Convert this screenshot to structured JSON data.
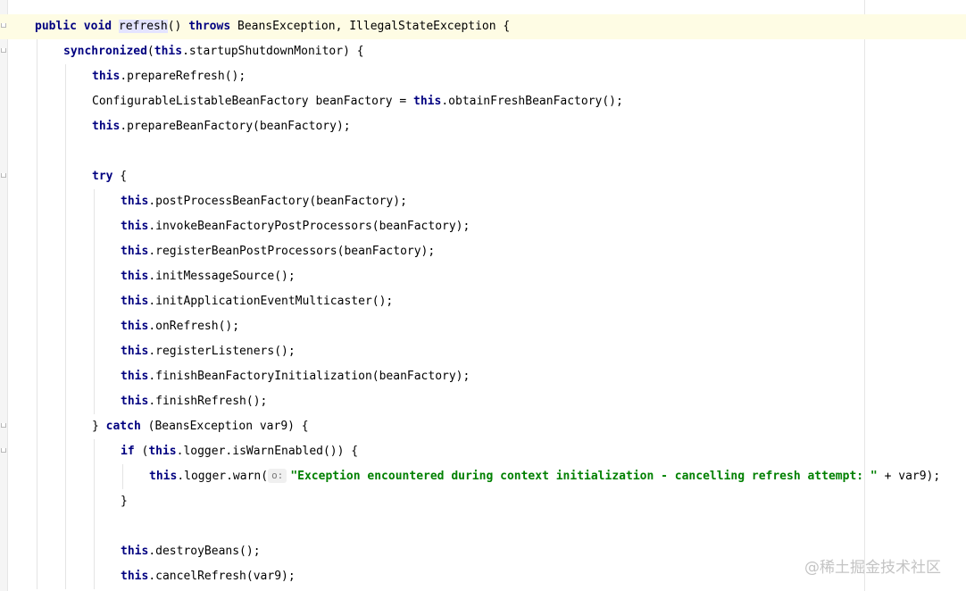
{
  "watermark": "@稀土掘金技术社区",
  "colors": {
    "keyword": "#000080",
    "string": "#008000",
    "current_line": "#fefce4",
    "usage_highlight": "#e4e4ff"
  },
  "code": {
    "lines": [
      {
        "indent": 1,
        "current": true,
        "tokens": [
          {
            "t": "public void ",
            "k": "kw"
          },
          {
            "t": "refresh",
            "k": "hl"
          },
          {
            "t": "() ",
            "k": ""
          },
          {
            "t": "throws",
            "k": "kw"
          },
          {
            "t": " BeansException, IllegalStateException {",
            "k": ""
          }
        ]
      },
      {
        "indent": 2,
        "tokens": [
          {
            "t": "synchronized",
            "k": "kw"
          },
          {
            "t": "(",
            "k": ""
          },
          {
            "t": "this",
            "k": "kw"
          },
          {
            "t": ".startupShutdownMonitor) {",
            "k": ""
          }
        ]
      },
      {
        "indent": 3,
        "tokens": [
          {
            "t": "this",
            "k": "kw"
          },
          {
            "t": ".prepareRefresh();",
            "k": ""
          }
        ]
      },
      {
        "indent": 3,
        "tokens": [
          {
            "t": "ConfigurableListableBeanFactory beanFactory = ",
            "k": ""
          },
          {
            "t": "this",
            "k": "kw"
          },
          {
            "t": ".obtainFreshBeanFactory();",
            "k": ""
          }
        ]
      },
      {
        "indent": 3,
        "tokens": [
          {
            "t": "this",
            "k": "kw"
          },
          {
            "t": ".prepareBeanFactory(beanFactory);",
            "k": ""
          }
        ]
      },
      {
        "indent": 3,
        "tokens": []
      },
      {
        "indent": 3,
        "tokens": [
          {
            "t": "try",
            "k": "kw"
          },
          {
            "t": " {",
            "k": ""
          }
        ]
      },
      {
        "indent": 4,
        "tokens": [
          {
            "t": "this",
            "k": "kw"
          },
          {
            "t": ".postProcessBeanFactory(beanFactory);",
            "k": ""
          }
        ]
      },
      {
        "indent": 4,
        "tokens": [
          {
            "t": "this",
            "k": "kw"
          },
          {
            "t": ".invokeBeanFactoryPostProcessors(beanFactory);",
            "k": ""
          }
        ]
      },
      {
        "indent": 4,
        "tokens": [
          {
            "t": "this",
            "k": "kw"
          },
          {
            "t": ".registerBeanPostProcessors(beanFactory);",
            "k": ""
          }
        ]
      },
      {
        "indent": 4,
        "tokens": [
          {
            "t": "this",
            "k": "kw"
          },
          {
            "t": ".initMessageSource();",
            "k": ""
          }
        ]
      },
      {
        "indent": 4,
        "tokens": [
          {
            "t": "this",
            "k": "kw"
          },
          {
            "t": ".initApplicationEventMulticaster();",
            "k": ""
          }
        ]
      },
      {
        "indent": 4,
        "tokens": [
          {
            "t": "this",
            "k": "kw"
          },
          {
            "t": ".onRefresh();",
            "k": ""
          }
        ]
      },
      {
        "indent": 4,
        "tokens": [
          {
            "t": "this",
            "k": "kw"
          },
          {
            "t": ".registerListeners();",
            "k": ""
          }
        ]
      },
      {
        "indent": 4,
        "tokens": [
          {
            "t": "this",
            "k": "kw"
          },
          {
            "t": ".finishBeanFactoryInitialization(beanFactory);",
            "k": ""
          }
        ]
      },
      {
        "indent": 4,
        "tokens": [
          {
            "t": "this",
            "k": "kw"
          },
          {
            "t": ".finishRefresh();",
            "k": ""
          }
        ]
      },
      {
        "indent": 3,
        "tokens": [
          {
            "t": "} ",
            "k": ""
          },
          {
            "t": "catch",
            "k": "kw"
          },
          {
            "t": " (BeansException var9) {",
            "k": ""
          }
        ]
      },
      {
        "indent": 4,
        "tokens": [
          {
            "t": "if",
            "k": "kw"
          },
          {
            "t": " (",
            "k": ""
          },
          {
            "t": "this",
            "k": "kw"
          },
          {
            "t": ".logger.isWarnEnabled()) {",
            "k": ""
          }
        ]
      },
      {
        "indent": 5,
        "tokens": [
          {
            "t": "this",
            "k": "kw"
          },
          {
            "t": ".logger.warn(",
            "k": ""
          },
          {
            "t": "o:",
            "k": "hint"
          },
          {
            "t": "\"Exception encountered during context initialization - cancelling refresh attempt: \"",
            "k": "str"
          },
          {
            "t": " + var9);",
            "k": ""
          }
        ]
      },
      {
        "indent": 4,
        "tokens": [
          {
            "t": "}",
            "k": ""
          }
        ]
      },
      {
        "indent": 4,
        "tokens": []
      },
      {
        "indent": 4,
        "tokens": [
          {
            "t": "this",
            "k": "kw"
          },
          {
            "t": ".destroyBeans();",
            "k": ""
          }
        ]
      },
      {
        "indent": 4,
        "tokens": [
          {
            "t": "this",
            "k": "kw"
          },
          {
            "t": ".cancelRefresh(var9);",
            "k": ""
          }
        ]
      }
    ]
  }
}
